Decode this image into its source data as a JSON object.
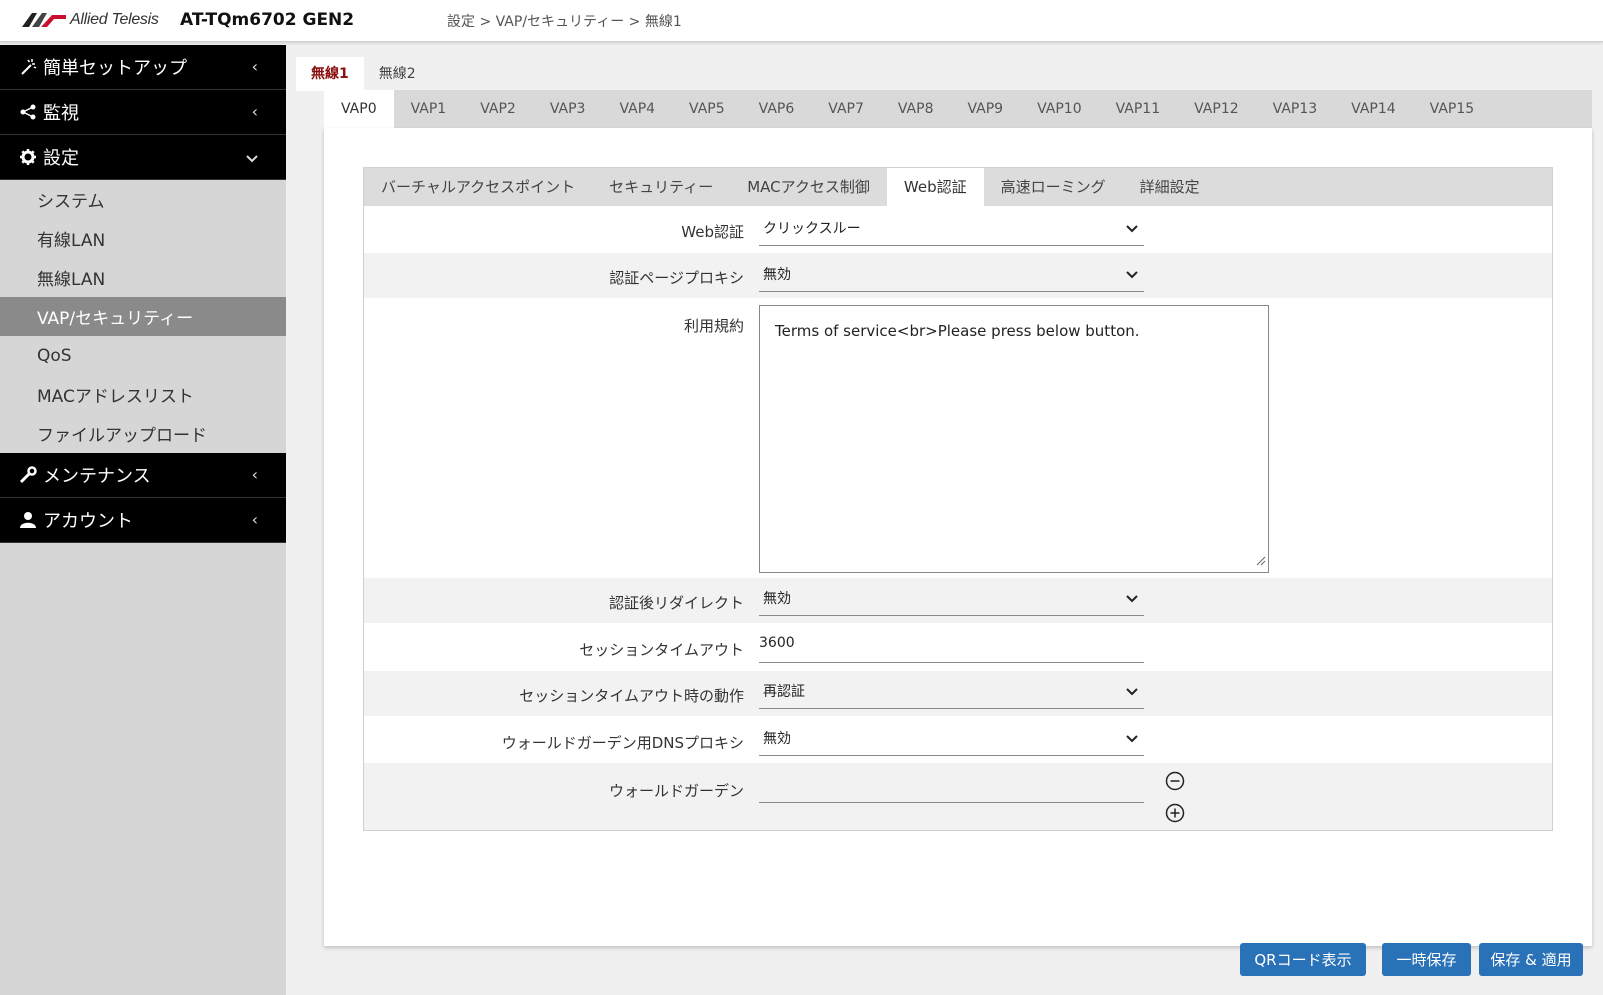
{
  "header": {
    "logo_text": "Allied Telesis",
    "model": "AT-TQm6702 GEN2",
    "breadcrumb": "設定 > VAP/セキュリティー > 無線1"
  },
  "sidebar": {
    "main_items": [
      {
        "label": "簡単セットアップ",
        "icon": "magic-wand-icon",
        "expanded": false
      },
      {
        "label": "監視",
        "icon": "share-icon",
        "expanded": false
      },
      {
        "label": "設定",
        "icon": "gear-icon",
        "expanded": true
      },
      {
        "label": "メンテナンス",
        "icon": "wrench-icon",
        "expanded": false
      },
      {
        "label": "アカウント",
        "icon": "user-icon",
        "expanded": false
      }
    ],
    "sub_items": [
      {
        "label": "システム"
      },
      {
        "label": "有線LAN"
      },
      {
        "label": "無線LAN"
      },
      {
        "label": "VAP/セキュリティー",
        "active": true
      },
      {
        "label": "QoS"
      },
      {
        "label": "MACアドレスリスト"
      },
      {
        "label": "ファイルアップロード"
      }
    ]
  },
  "radio_tabs": [
    "無線1",
    "無線2"
  ],
  "radio_active": "無線1",
  "vap_tabs": [
    "VAP0",
    "VAP1",
    "VAP2",
    "VAP3",
    "VAP4",
    "VAP5",
    "VAP6",
    "VAP7",
    "VAP8",
    "VAP9",
    "VAP10",
    "VAP11",
    "VAP12",
    "VAP13",
    "VAP14",
    "VAP15"
  ],
  "vap_active": "VAP0",
  "sub_tabs": [
    "バーチャルアクセスポイント",
    "セキュリティー",
    "MACアクセス制御",
    "Web認証",
    "高速ローミング",
    "詳細設定"
  ],
  "sub_active": "Web認証",
  "form": {
    "web_auth": {
      "label": "Web認証",
      "value": "クリックスルー"
    },
    "auth_page_proxy": {
      "label": "認証ページプロキシ",
      "value": "無効"
    },
    "terms": {
      "label": "利用規約",
      "value": "Terms of service<br>Please press below button."
    },
    "redirect": {
      "label": "認証後リダイレクト",
      "value": "無効"
    },
    "session_timeout": {
      "label": "セッションタイムアウト",
      "value": "3600"
    },
    "timeout_action": {
      "label": "セッションタイムアウト時の動作",
      "value": "再認証"
    },
    "walled_dns_proxy": {
      "label": "ウォールドガーデン用DNSプロキシ",
      "value": "無効"
    },
    "walled_garden": {
      "label": "ウォールドガーデン",
      "value": ""
    }
  },
  "buttons": {
    "qr": "QRコード表示",
    "temp_save": "一時保存",
    "save_apply": "保存 & 適用"
  },
  "colors": {
    "accent_button": "#2a72b8",
    "active_radio_tab": "#8a0e0e",
    "sidebar_active": "#8a8a8a"
  }
}
